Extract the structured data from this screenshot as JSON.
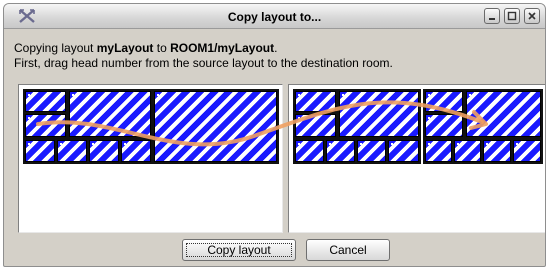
{
  "window": {
    "title": "Copy layout to...",
    "icon": "cross-arrows-icon",
    "controls": [
      "minimize-icon",
      "maximize-icon",
      "close-icon"
    ]
  },
  "message": {
    "prefix": "Copying layout ",
    "layout_name": "myLayout",
    "middle": " to ",
    "destination": "ROOM1/myLayout",
    "suffix": ".",
    "instruction": "First, drag head number from the source layout to the destination room."
  },
  "buttons": {
    "copy_label": "Copy layout",
    "cancel_label": "Cancel"
  },
  "colors": {
    "stripe_blue": "#1a1aff",
    "arrow_orange": "#f0a060"
  }
}
